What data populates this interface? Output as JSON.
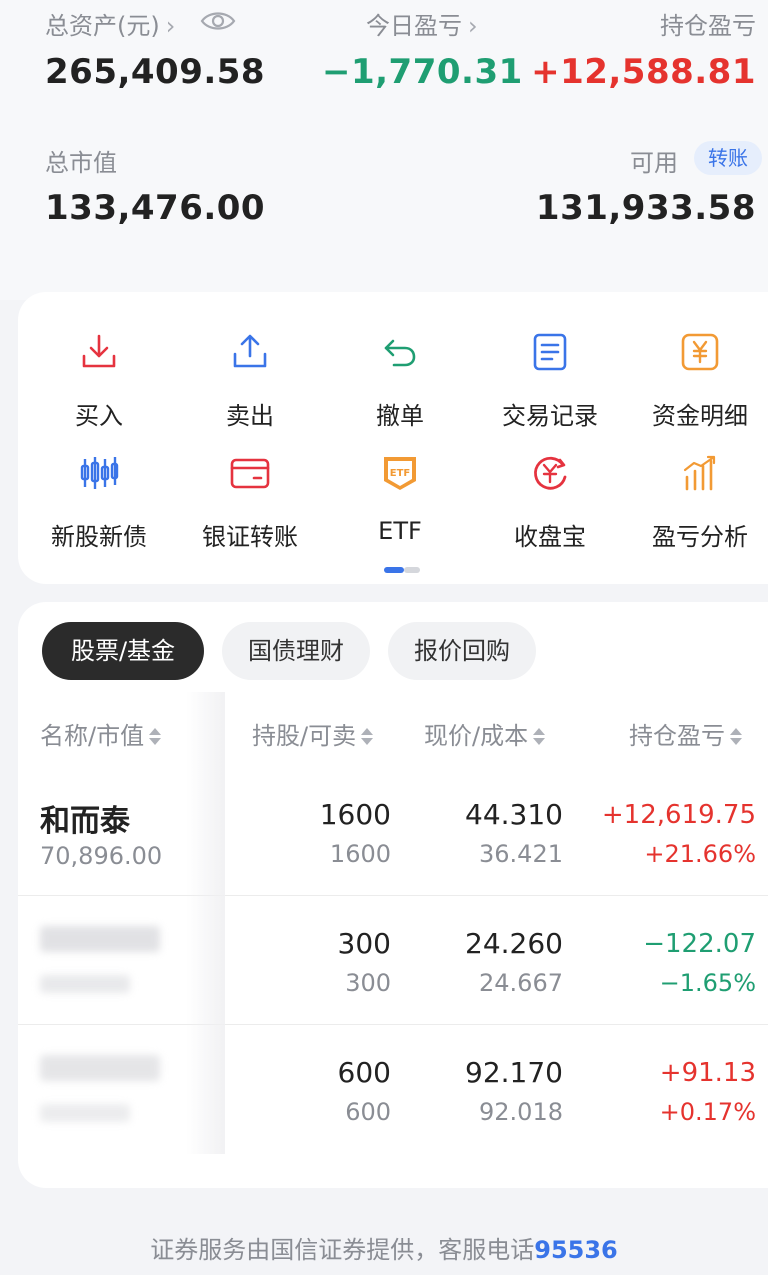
{
  "summary": {
    "total_assets_label": "总资产(元)",
    "total_assets_value": "265,409.58",
    "today_pnl_label": "今日盈亏",
    "today_pnl_value": "−1,770.31",
    "position_pnl_label": "持仓盈亏",
    "position_pnl_value": "+12,588.81",
    "market_value_label": "总市值",
    "market_value_value": "133,476.00",
    "available_label": "可用",
    "available_value": "131,933.58",
    "transfer_badge": "转账",
    "eye_icon": "eye-icon",
    "chevron_icon": "chevron-right-icon"
  },
  "actions": [
    {
      "label": "买入",
      "icon": "download-icon",
      "color": "#e5333f"
    },
    {
      "label": "卖出",
      "icon": "upload-icon",
      "color": "#3a74e8"
    },
    {
      "label": "撤单",
      "icon": "undo-icon",
      "color": "#1f9e72"
    },
    {
      "label": "交易记录",
      "icon": "document-icon",
      "color": "#3a74e8"
    },
    {
      "label": "资金明细",
      "icon": "yuan-icon",
      "color": "#f29a34"
    },
    {
      "label": "新股新债",
      "icon": "candlestick-icon",
      "color": "#3a74e8"
    },
    {
      "label": "银证转账",
      "icon": "card-icon",
      "color": "#e5333f"
    },
    {
      "label": "ETF",
      "icon": "etf-icon",
      "color": "#f29a34"
    },
    {
      "label": "收盘宝",
      "icon": "yuan-cycle-icon",
      "color": "#e5333f"
    },
    {
      "label": "盈亏分析",
      "icon": "bar-chart-icon",
      "color": "#f29a34"
    }
  ],
  "tabs": [
    {
      "label": "股票/基金",
      "active": true
    },
    {
      "label": "国债理财",
      "active": false
    },
    {
      "label": "报价回购",
      "active": false
    }
  ],
  "table": {
    "headers": [
      "名称/市值",
      "持股/可卖",
      "现价/成本",
      "持仓盈亏"
    ],
    "rows": [
      {
        "name": "和而泰",
        "market_value": "70,896.00",
        "shares": "1600",
        "sellable": "1600",
        "price": "44.310",
        "cost": "36.421",
        "pnl": "+12,619.75",
        "pnl_pct": "+21.66%",
        "trend": "up"
      },
      {
        "name": "",
        "market_value": "",
        "shares": "300",
        "sellable": "300",
        "price": "24.260",
        "cost": "24.667",
        "pnl": "−122.07",
        "pnl_pct": "−1.65%",
        "trend": "down"
      },
      {
        "name": "",
        "market_value": "",
        "shares": "600",
        "sellable": "600",
        "price": "92.170",
        "cost": "92.018",
        "pnl": "+91.13",
        "pnl_pct": "+0.17%",
        "trend": "up"
      }
    ]
  },
  "footer": {
    "text": "证券服务由国信证券提供，客服电话",
    "phone": "95536"
  },
  "colors": {
    "up": "#e5332e",
    "down": "#1f9e72",
    "accent": "#3a74e8"
  }
}
